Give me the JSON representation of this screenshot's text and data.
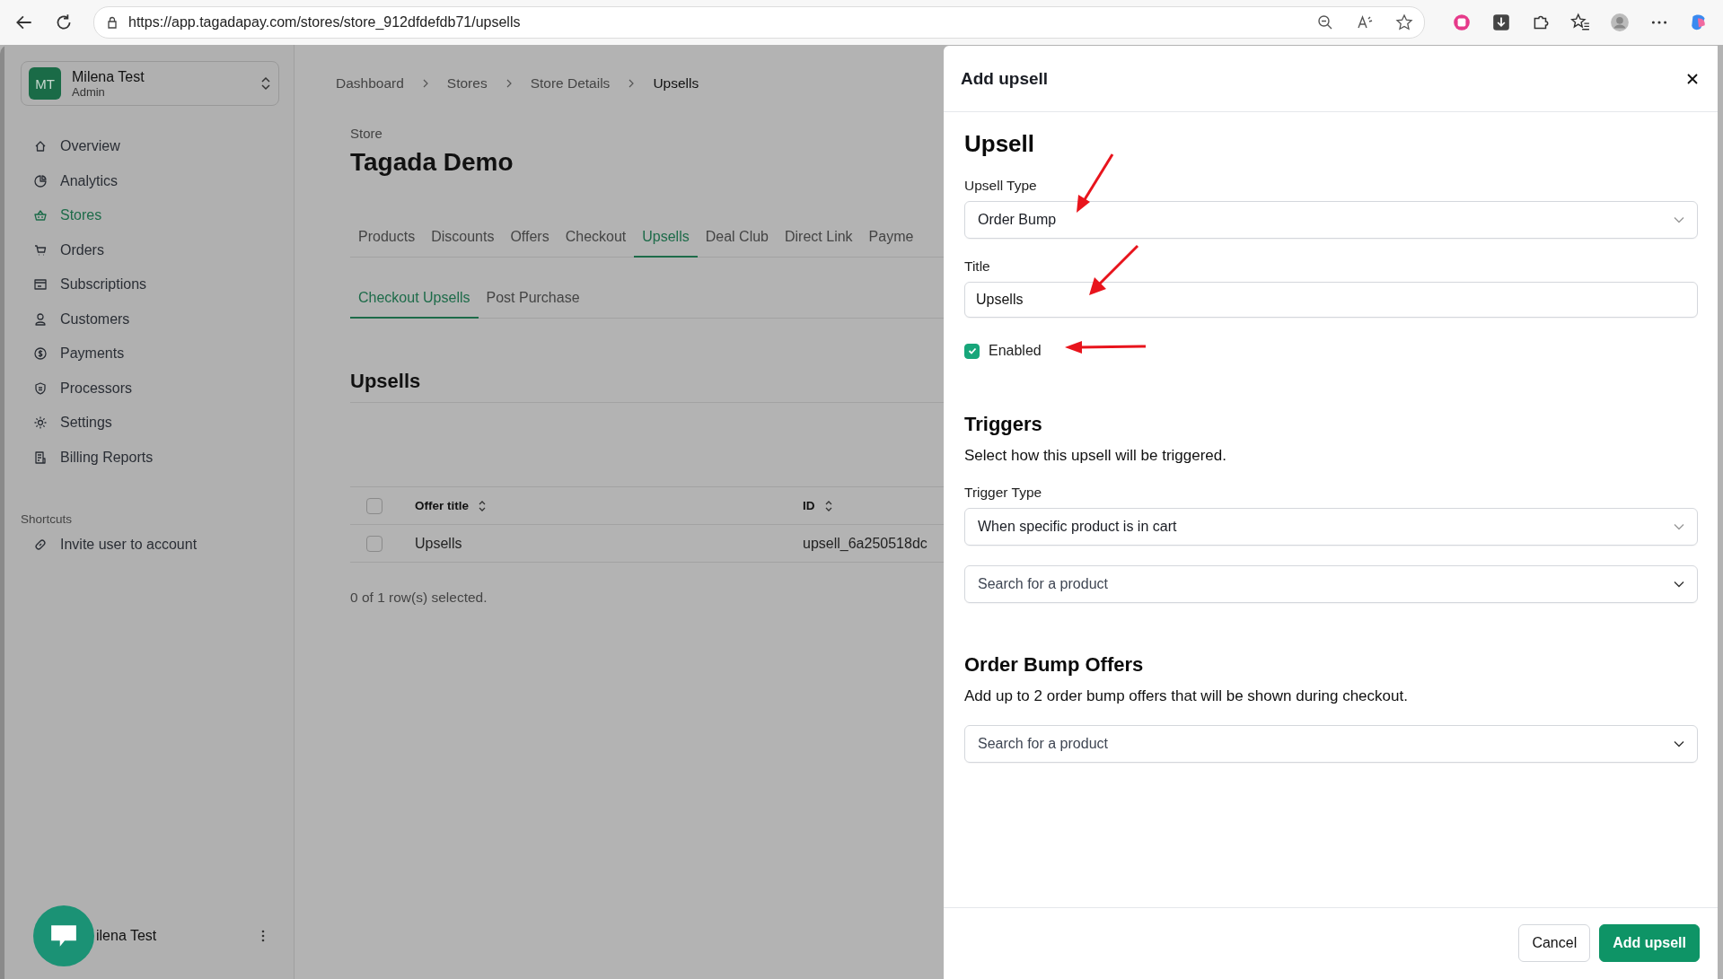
{
  "browser": {
    "url": "https://app.tagadapay.com/stores/store_912dfdefdb71/upsells"
  },
  "sidebar": {
    "account": {
      "initials": "MT",
      "name": "Milena Test",
      "role": "Admin"
    },
    "nav": [
      {
        "label": "Overview",
        "selected": false
      },
      {
        "label": "Analytics",
        "selected": false
      },
      {
        "label": "Stores",
        "selected": true
      },
      {
        "label": "Orders",
        "selected": false
      },
      {
        "label": "Subscriptions",
        "selected": false
      },
      {
        "label": "Customers",
        "selected": false
      },
      {
        "label": "Payments",
        "selected": false
      },
      {
        "label": "Processors",
        "selected": false
      },
      {
        "label": "Settings",
        "selected": false
      },
      {
        "label": "Billing Reports",
        "selected": false
      }
    ],
    "shortcuts_title": "Shortcuts",
    "shortcuts": [
      {
        "label": "Invite user to account"
      }
    ],
    "footer_user": "ilena Test"
  },
  "main": {
    "breadcrumb": [
      "Dashboard",
      "Stores",
      "Store Details",
      "Upsells"
    ],
    "store_label": "Store",
    "store_name": "Tagada Demo",
    "tabs": [
      {
        "label": "Products",
        "selected": false
      },
      {
        "label": "Discounts",
        "selected": false
      },
      {
        "label": "Offers",
        "selected": false
      },
      {
        "label": "Checkout",
        "selected": false
      },
      {
        "label": "Upsells",
        "selected": true
      },
      {
        "label": "Deal Club",
        "selected": false
      },
      {
        "label": "Direct Link",
        "selected": false
      },
      {
        "label": "Payme",
        "selected": false
      }
    ],
    "subtabs": [
      {
        "label": "Checkout Upsells",
        "selected": true
      },
      {
        "label": "Post Purchase",
        "selected": false
      }
    ],
    "section_title": "Upsells",
    "table": {
      "header_checked": false,
      "columns": [
        "Offer title",
        "ID"
      ],
      "rows": [
        {
          "checked": false,
          "cells": [
            "Upsells",
            "upsell_6a250518dc"
          ]
        }
      ]
    },
    "selection_note": "0 of 1 row(s) selected."
  },
  "drawer": {
    "title": "Add upsell",
    "sections": [
      {
        "heading": "Upsell",
        "fields": [
          {
            "kind": "select",
            "label": "Upsell Type",
            "value": "Order Bump"
          },
          {
            "kind": "text",
            "label": "Title",
            "value": "Upsells"
          },
          {
            "kind": "checkbox",
            "label": "Enabled",
            "checked": true
          }
        ]
      },
      {
        "heading": "Triggers",
        "description": "Select how this upsell will be triggered.",
        "fields": [
          {
            "kind": "select",
            "label": "Trigger Type",
            "value": "When specific product is in cart"
          },
          {
            "kind": "select",
            "placeholder": "Search for a product"
          }
        ]
      },
      {
        "heading": "Order Bump Offers",
        "description": "Add up to 2 order bump offers that will be shown during checkout.",
        "fields": [
          {
            "kind": "select",
            "placeholder": "Search for a product"
          }
        ]
      }
    ],
    "buttons": [
      {
        "label": "Cancel",
        "kind": "secondary"
      },
      {
        "label": "Add upsell",
        "kind": "primary"
      }
    ]
  }
}
